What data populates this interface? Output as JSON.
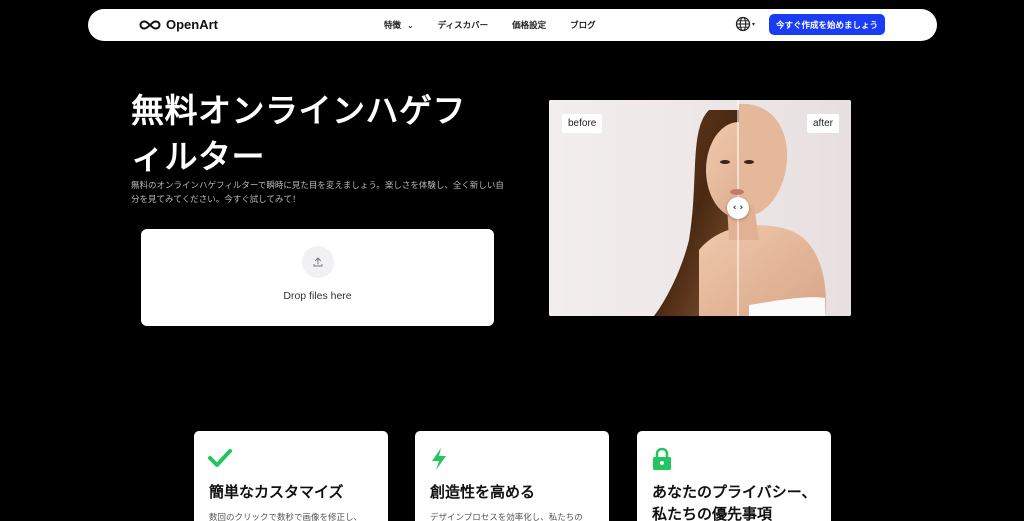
{
  "nav": {
    "brand": "OpenArt",
    "links": [
      {
        "label": "特徴",
        "has_dropdown": true
      },
      {
        "label": "ディスカバー"
      },
      {
        "label": "価格設定"
      },
      {
        "label": "ブログ"
      }
    ],
    "language_icon": "globe-icon",
    "cta_label": "今すぐ作成を始めましょう"
  },
  "hero": {
    "title": "無料オンラインハゲフィルター",
    "subtitle": "無料のオンラインハゲフィルターで瞬時に見た目を変えましょう。楽しさを体験し、全く新しい自分を見てみてください。今すぐ試してみて！"
  },
  "dropzone": {
    "label": "Drop files here",
    "icon": "upload-icon"
  },
  "compare": {
    "before_label": "before",
    "after_label": "after",
    "handle_icon": "chevron-left-right-icon",
    "split_fraction": 0.62
  },
  "features": [
    {
      "title": "簡単なカスタマイズ",
      "desc": "数回のクリックで数秒で画像を修正し、",
      "icon": "check-icon",
      "color": "#22c55e"
    },
    {
      "title": "創造性を高める",
      "desc": "デザインプロセスを効率化し、私たちの",
      "icon": "lightning-icon",
      "color": "#22c55e"
    },
    {
      "title": "あなたのプライバシー、私たちの優先事項",
      "desc": "",
      "icon": "lock-icon",
      "color": "#22c55e"
    }
  ],
  "colors": {
    "accent": "#1b3cf5",
    "background": "#000000",
    "feature_icon": "#22c55e"
  }
}
